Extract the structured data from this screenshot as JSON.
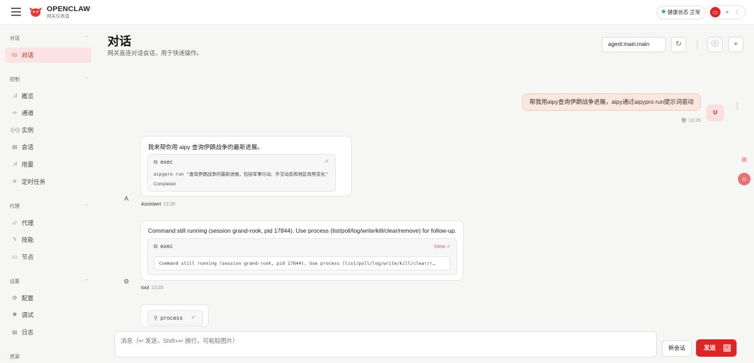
{
  "header": {
    "brand_name": "OPENCLAW",
    "brand_sub": "网关仪表盘",
    "health_label": "健康状态",
    "health_value": "正常"
  },
  "sidebar": {
    "sections": [
      {
        "label": "对话",
        "chevron": "−"
      },
      {
        "label": "控制",
        "chevron": "−"
      },
      {
        "label": "代理",
        "chevron": "−"
      },
      {
        "label": "设置",
        "chevron": "−"
      },
      {
        "label": "资源"
      }
    ],
    "items": [
      {
        "label": "对话",
        "icon": "chat-icon"
      },
      {
        "label": "概览",
        "icon": "bar-chart-icon"
      },
      {
        "label": "通道",
        "icon": "link-icon"
      },
      {
        "label": "实例",
        "icon": "broadcast-icon"
      },
      {
        "label": "会话",
        "icon": "document-icon"
      },
      {
        "label": "用量",
        "icon": "bar-chart-icon"
      },
      {
        "label": "定时任务",
        "icon": "loader-icon"
      },
      {
        "label": "代理",
        "icon": "folder-icon"
      },
      {
        "label": "技能",
        "icon": "zap-icon"
      },
      {
        "label": "节点",
        "icon": "monitor-icon"
      },
      {
        "label": "配置",
        "icon": "gear-icon"
      },
      {
        "label": "调试",
        "icon": "bug-icon"
      },
      {
        "label": "日志",
        "icon": "log-icon"
      }
    ]
  },
  "main": {
    "title": "对话",
    "subtitle": "网关直连对话会话，用于快速操作。",
    "session_key": "agent:main:main"
  },
  "messages": {
    "user": {
      "text": "帮我用aipy查询伊朗战争进展，aipy通过aipypro run提示词驱动",
      "author": "你",
      "time": "13:28",
      "avatar": "U"
    },
    "assistant": {
      "text": "我来帮你用 aipy 查询伊朗战争的最新进展。",
      "tool_name": "exec",
      "command": "aipypro run \"查询伊朗战争的最新进展，包括军事行动、外交动态和地区局势变化\"",
      "status": "Completed",
      "author": "Assistant",
      "time": "13:28",
      "avatar": "A"
    },
    "tool": {
      "text": "Command still running (session grand-rook, pid 17844). Use process (list/poll/log/write/kill/clear/remove) for follow-up.",
      "tool_name": "exec",
      "view_label": "View ✓",
      "output": "Command still running (session grand-rook, pid 17844). Use process (list/poll/log/write/kill/clear/r…",
      "author": "tool",
      "time": "13:28"
    },
    "process": {
      "tool_name": "process"
    }
  },
  "composer": {
    "placeholder": "消息（↩ 发送，Shift+↩ 换行，可粘贴图片）",
    "new_session_label": "新会话",
    "send_label": "发送"
  },
  "colors": {
    "accent": "#dc2626",
    "active_bg": "#fbe3e3",
    "user_bubble": "#fbe7dd",
    "health_dot": "#22c55e"
  }
}
